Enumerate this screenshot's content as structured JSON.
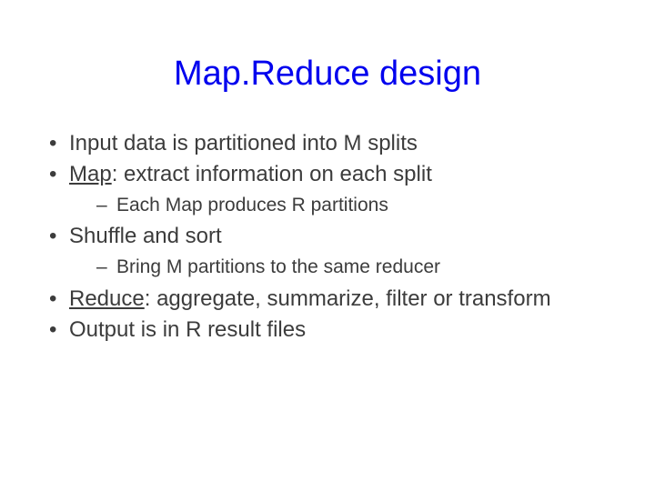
{
  "title": "Map.Reduce design",
  "bullets": {
    "b0": "Input data is partitioned into M splits",
    "b1_pre": "",
    "b1_u": "Map",
    "b1_post": ": extract information on each split",
    "b1_sub0": "Each Map produces R partitions",
    "b2": "Shuffle and sort",
    "b2_sub0": "Bring M partitions to the same reducer",
    "b3_pre": "",
    "b3_u": "Reduce",
    "b3_post": ": aggregate, summarize, filter or transform",
    "b4": "Output is in R result files"
  }
}
